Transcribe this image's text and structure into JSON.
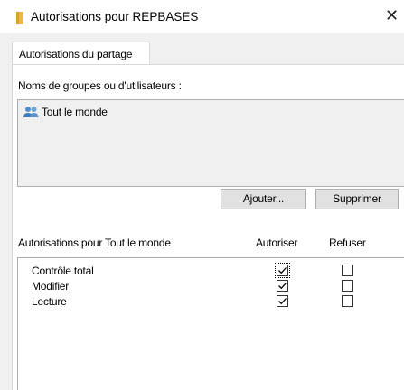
{
  "window": {
    "title": "Autorisations pour REPBASES",
    "close_icon": "close-icon"
  },
  "tabs": [
    {
      "label": "Autorisations du partage",
      "active": true
    }
  ],
  "groups": {
    "label": "Noms de groupes ou d'utilisateurs :",
    "items": [
      {
        "label": "Tout le monde",
        "icon": "users-icon",
        "selected": true
      }
    ]
  },
  "buttons": {
    "add_label": "Ajouter...",
    "remove_label": "Supprimer"
  },
  "permissions": {
    "label": "Autorisations pour Tout le monde",
    "col_allow": "Autoriser",
    "col_deny": "Refuser",
    "rows": [
      {
        "name": "Contrôle total",
        "allow": true,
        "deny": false
      },
      {
        "name": "Modifier",
        "allow": true,
        "deny": false
      },
      {
        "name": "Lecture",
        "allow": true,
        "deny": false
      }
    ]
  },
  "colors": {
    "folder": "#e8b84a",
    "users_icon": "#3a7ebf"
  }
}
